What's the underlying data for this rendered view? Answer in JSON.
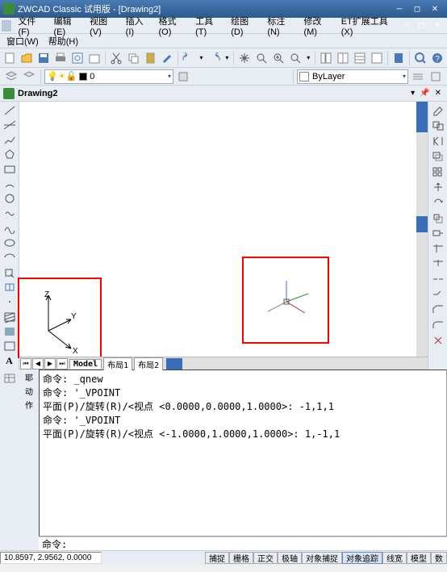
{
  "title": "ZWCAD Classic 试用版 - [Drawing2]",
  "menu": [
    "文件(F)",
    "编辑(E)",
    "视图(V)",
    "插入(I)",
    "格式(O)",
    "工具(T)",
    "绘图(D)",
    "标注(N)",
    "修改(M)",
    "ET扩展工具(X)"
  ],
  "menu2": [
    "窗口(W)",
    "帮助(H)"
  ],
  "layer": {
    "current": "0",
    "bylayer": "ByLayer"
  },
  "doc": {
    "name": "Drawing2"
  },
  "tabs": {
    "model": "Model",
    "l1": "布局1",
    "l2": "布局2"
  },
  "cmd": {
    "lines": [
      "命令: _qnew",
      "命令: '_VPOINT",
      "平面(P)/旋转(R)/<视点 <0.0000,0.0000,1.0000>: -1,1,1",
      "命令: '_VPOINT",
      "平面(P)/旋转(R)/<视点 <-1.0000,1.0000,1.0000>: 1,-1,1"
    ],
    "prompt": "命令:"
  },
  "status": {
    "coords": "10.8597, 2.9562, 0.0000",
    "btns": [
      "捕捉",
      "栅格",
      "正交",
      "极轴",
      "对象捕捉",
      "对象追踪",
      "线宽",
      "模型",
      "数"
    ]
  },
  "axes": {
    "x": "X",
    "y": "Y",
    "z": "Z"
  }
}
